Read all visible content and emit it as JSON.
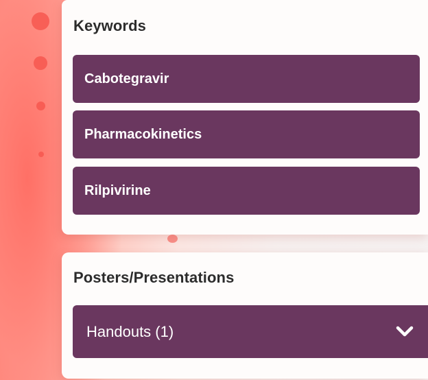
{
  "keywords": {
    "title": "Keywords",
    "items": [
      {
        "label": "Cabotegravir"
      },
      {
        "label": "Pharmacokinetics"
      },
      {
        "label": "Rilpivirine"
      }
    ]
  },
  "posters": {
    "title": "Posters/Presentations",
    "dropdown": {
      "selected": "Handouts (1)",
      "icon": "chevron-down-icon"
    }
  },
  "colors": {
    "pill": "#6a375f",
    "background_accent": "#ff8478",
    "card": "#fefcfb"
  }
}
